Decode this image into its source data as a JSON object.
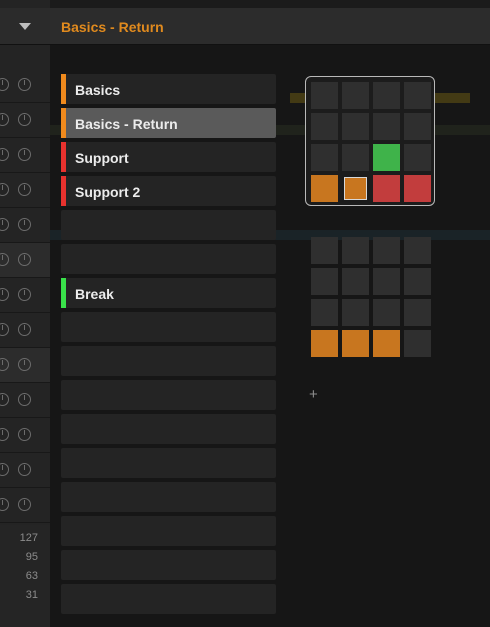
{
  "header": {
    "title": "Basics - Return"
  },
  "scenes": [
    {
      "label": "Basics",
      "color": "#f08a1d",
      "selected": false
    },
    {
      "label": "Basics - Return",
      "color": "#f08a1d",
      "selected": true
    },
    {
      "label": "Support",
      "color": "#e8322e",
      "selected": false
    },
    {
      "label": "Support 2",
      "color": "#e8322e",
      "selected": false
    },
    {
      "label": "",
      "color": "",
      "selected": false
    },
    {
      "label": "",
      "color": "",
      "selected": false
    },
    {
      "label": "Break",
      "color": "#39e14a",
      "selected": false
    },
    {
      "label": "",
      "color": "",
      "selected": false
    },
    {
      "label": "",
      "color": "",
      "selected": false
    },
    {
      "label": "",
      "color": "",
      "selected": false
    },
    {
      "label": "",
      "color": "",
      "selected": false
    },
    {
      "label": "",
      "color": "",
      "selected": false
    },
    {
      "label": "",
      "color": "",
      "selected": false
    },
    {
      "label": "",
      "color": "",
      "selected": false
    },
    {
      "label": "",
      "color": "",
      "selected": false
    },
    {
      "label": "",
      "color": "",
      "selected": false
    }
  ],
  "velocity_scale": [
    "127",
    "95",
    "63",
    "31"
  ],
  "pad_grids": [
    {
      "cells": [
        "empty",
        "empty",
        "empty",
        "empty",
        "empty",
        "empty",
        "empty",
        "empty",
        "empty",
        "empty",
        "green",
        "empty",
        "orange",
        "orange-selected",
        "red",
        "red"
      ]
    },
    {
      "cells": [
        "empty",
        "empty",
        "empty",
        "empty",
        "empty",
        "empty",
        "empty",
        "empty",
        "empty",
        "empty",
        "empty",
        "empty",
        "orange",
        "orange",
        "orange",
        "empty"
      ]
    }
  ],
  "pad_colors": {
    "empty": "#2f2f2f",
    "green": "#3fb34a",
    "orange": "#c8761f",
    "orange-selected": "#c8761f",
    "red": "#c23d3d"
  },
  "add_label": "+"
}
